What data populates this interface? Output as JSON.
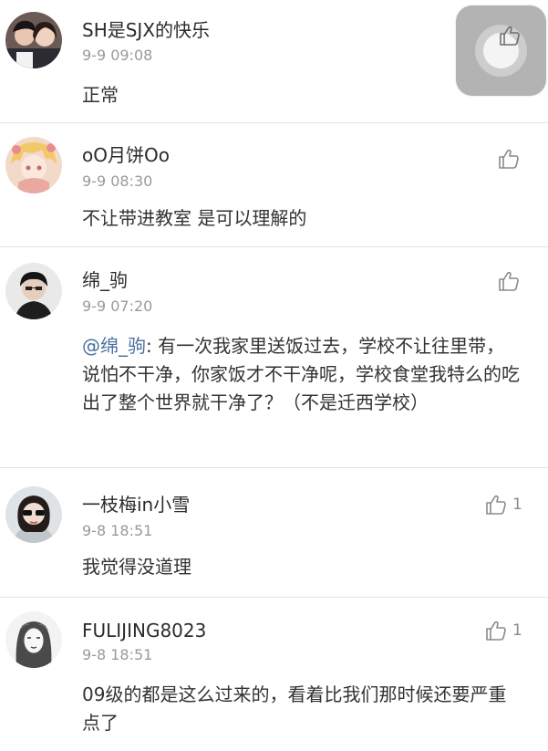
{
  "comments": [
    {
      "name": "SH是SJX的快乐",
      "time": "9-9 09:08",
      "body": "正常",
      "likes": ""
    },
    {
      "name": "oO月饼Oo",
      "time": "9-9 08:30",
      "body": "不让带进教室 是可以理解的",
      "likes": ""
    },
    {
      "name": "绵_驹",
      "time": "9-9 07:20",
      "mention": "@绵_驹",
      "body": ": 有一次我家里送饭过去，学校不让往里带，说怕不干净，你家饭才不干净呢，学校食堂我特么的吃出了整个世界就干净了？（不是迁西学校）",
      "likes": ""
    },
    {
      "name": "一枝梅in小雪",
      "time": "9-8 18:51",
      "body": "我觉得没道理",
      "likes": "1"
    },
    {
      "name": "FULIJING8023",
      "time": "9-8 18:51",
      "body": "09级的都是这么过来的，看着比我们那时候还要严重点了",
      "likes": "1"
    }
  ],
  "icons": {
    "like": "thumbs-up-icon",
    "floating": "assistive-touch-icon"
  },
  "colors": {
    "name": "#2b2b2b",
    "time": "#9a9a9a",
    "body": "#333333",
    "mention": "#4a6fa0",
    "divider": "#e3e3e3"
  }
}
